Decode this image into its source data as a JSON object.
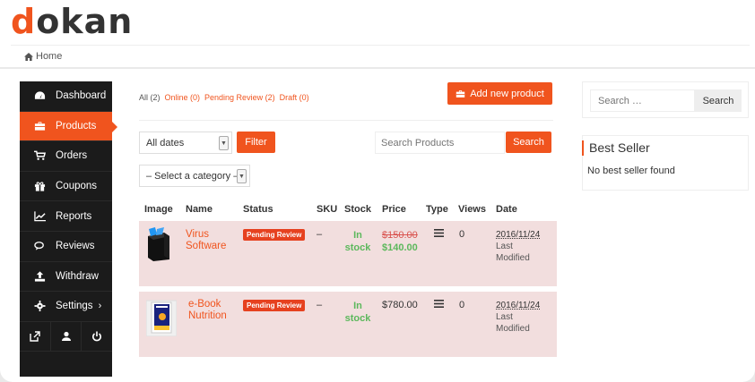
{
  "brand": {
    "logo_first": "d",
    "logo_rest": "okan",
    "accent": "#f0541e"
  },
  "breadcrumb": {
    "label": "Home",
    "icon": "home-icon"
  },
  "sidebar": {
    "items": [
      {
        "label": "Dashboard",
        "icon": "dashboard-icon"
      },
      {
        "label": "Products",
        "icon": "briefcase-icon",
        "active": true
      },
      {
        "label": "Orders",
        "icon": "cart-icon"
      },
      {
        "label": "Coupons",
        "icon": "gift-icon"
      },
      {
        "label": "Reports",
        "icon": "chart-icon"
      },
      {
        "label": "Reviews",
        "icon": "comments-icon"
      },
      {
        "label": "Withdraw",
        "icon": "upload-icon"
      },
      {
        "label": "Settings",
        "icon": "gear-icon",
        "caret": "›"
      }
    ],
    "bottom": [
      "external-link-icon",
      "user-icon",
      "power-icon"
    ]
  },
  "filters": {
    "items": [
      {
        "label": "All (2)",
        "current": true
      },
      {
        "label": "Online (0)"
      },
      {
        "label": "Pending Review (2)"
      },
      {
        "label": "Draft (0)"
      }
    ]
  },
  "toolbar": {
    "add_label": "Add new product",
    "date_select": "All dates",
    "filter_label": "Filter",
    "search_placeholder": "Search Products",
    "search_label": "Search",
    "category_select": "– Select a category –"
  },
  "table": {
    "headers": [
      "Image",
      "Name",
      "Status",
      "SKU",
      "Stock",
      "Price",
      "Type",
      "Views",
      "Date"
    ],
    "rows": [
      {
        "name_line1": "Virus",
        "name_line2": "Software",
        "status": "Pending Review",
        "sku": "–",
        "stock_line1": "In",
        "stock_line2": "stock",
        "price_old": "$150.00",
        "price_new": "$140.00",
        "views": "0",
        "date": "2016/11/24",
        "date_note_1": "Last",
        "date_note_2": "Modified"
      },
      {
        "name_line1": "e-Book",
        "name_line2": "Nutrition",
        "status": "Pending Review",
        "sku": "–",
        "stock_line1": "In",
        "stock_line2": "stock",
        "price": "$780.00",
        "views": "0",
        "date": "2016/11/24",
        "date_note_1": "Last",
        "date_note_2": "Modified"
      }
    ]
  },
  "widgets": {
    "search_placeholder": "Search …",
    "search_label": "Search",
    "best_seller_title": "Best Seller",
    "best_seller_text": "No best seller found"
  }
}
